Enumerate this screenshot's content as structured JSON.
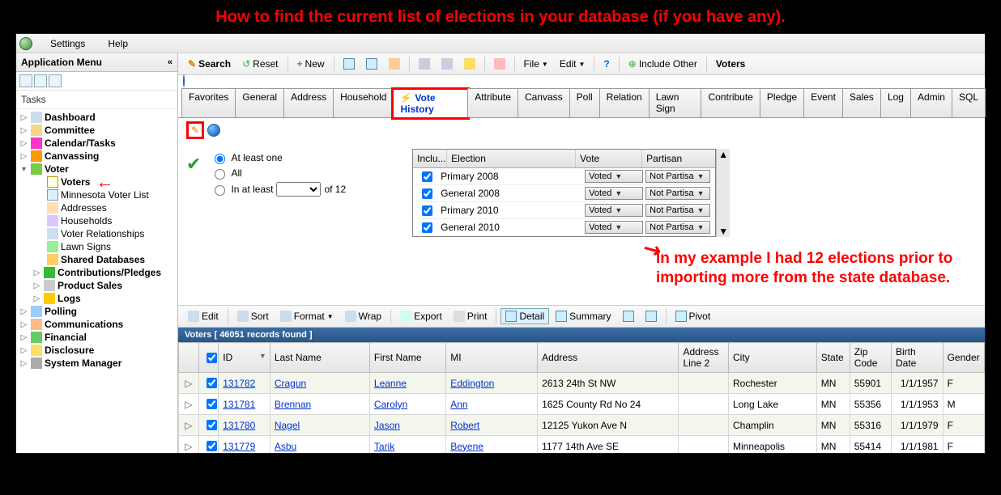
{
  "annotations": {
    "top": "How to find the current list of elections in your database (if you have any).",
    "side": "In my example I had 12 elections prior to importing more from the state database."
  },
  "menubar": {
    "settings": "Settings",
    "help": "Help"
  },
  "left": {
    "title": "Application Menu",
    "tasks": "Tasks",
    "items": {
      "dashboard": "Dashboard",
      "committee": "Committee",
      "calendar": "Calendar/Tasks",
      "canvassing": "Canvassing",
      "voter": "Voter",
      "voters": "Voters",
      "mnvoter": "Minnesota Voter List",
      "addresses": "Addresses",
      "households": "Households",
      "relationships": "Voter Relationships",
      "lawnsigns": "Lawn Signs",
      "shareddb": "Shared Databases",
      "contrib": "Contributions/Pledges",
      "productsales": "Product Sales",
      "logs": "Logs",
      "polling": "Polling",
      "communications": "Communications",
      "financial": "Financial",
      "disclosure": "Disclosure",
      "sysmgr": "System Manager"
    }
  },
  "toolbar": {
    "search": "Search",
    "reset": "Reset",
    "new": "New",
    "file": "File",
    "edit": "Edit",
    "include": "Include Other",
    "voters": "Voters"
  },
  "tabs": [
    "Favorites",
    "General",
    "Address",
    "Household",
    "Vote History",
    "Attribute",
    "Canvass",
    "Poll",
    "Relation",
    "Lawn Sign",
    "Contribute",
    "Pledge",
    "Event",
    "Sales",
    "Log",
    "Admin",
    "SQL"
  ],
  "activeTab": 4,
  "filter": {
    "atleastone": "At least one",
    "all": "All",
    "inatleast": "In at least",
    "of": "of 12"
  },
  "electionsHeader": {
    "incl": "Inclu...",
    "election": "Election",
    "vote": "Vote",
    "partisan": "Partisan"
  },
  "elections": [
    {
      "name": "Primary 2008",
      "vote": "Voted",
      "partisan": "Not Partisan"
    },
    {
      "name": "General 2008",
      "vote": "Voted",
      "partisan": "Not Partisan"
    },
    {
      "name": "Primary 2010",
      "vote": "Voted",
      "partisan": "Not Partisan"
    },
    {
      "name": "General 2010",
      "vote": "Voted",
      "partisan": "Not Partisan"
    }
  ],
  "gridbar": {
    "edit": "Edit",
    "sort": "Sort",
    "format": "Format",
    "wrap": "Wrap",
    "export": "Export",
    "print": "Print",
    "detail": "Detail",
    "summary": "Summary",
    "pivot": "Pivot"
  },
  "gridStatus": "Voters [ 46051 records found ]",
  "columns": {
    "id": "ID",
    "last": "Last Name",
    "first": "First Name",
    "mi": "MI",
    "address": "Address",
    "addr2": "Address Line 2",
    "city": "City",
    "state": "State",
    "zip": "Zip Code",
    "birth": "Birth Date",
    "gender": "Gender"
  },
  "rows": [
    {
      "id": "131782",
      "last": "Cragun",
      "first": "Leanne",
      "mi": "Eddington",
      "address": "2613 24th St NW",
      "addr2": "",
      "city": "Rochester",
      "state": "MN",
      "zip": "55901",
      "birth": "1/1/1957",
      "gender": "F"
    },
    {
      "id": "131781",
      "last": "Brennan",
      "first": "Carolyn",
      "mi": "Ann",
      "address": "1625 County Rd No 24",
      "addr2": "",
      "city": "Long Lake",
      "state": "MN",
      "zip": "55356",
      "birth": "1/1/1953",
      "gender": "M"
    },
    {
      "id": "131780",
      "last": "Nagel",
      "first": "Jason",
      "mi": "Robert",
      "address": "12125 Yukon Ave N",
      "addr2": "",
      "city": "Champlin",
      "state": "MN",
      "zip": "55316",
      "birth": "1/1/1979",
      "gender": "F"
    },
    {
      "id": "131779",
      "last": "Asbu",
      "first": "Tarik",
      "mi": "Beyene",
      "address": "1177 14th Ave SE",
      "addr2": "",
      "city": "Minneapolis",
      "state": "MN",
      "zip": "55414",
      "birth": "1/1/1981",
      "gender": "F"
    }
  ]
}
